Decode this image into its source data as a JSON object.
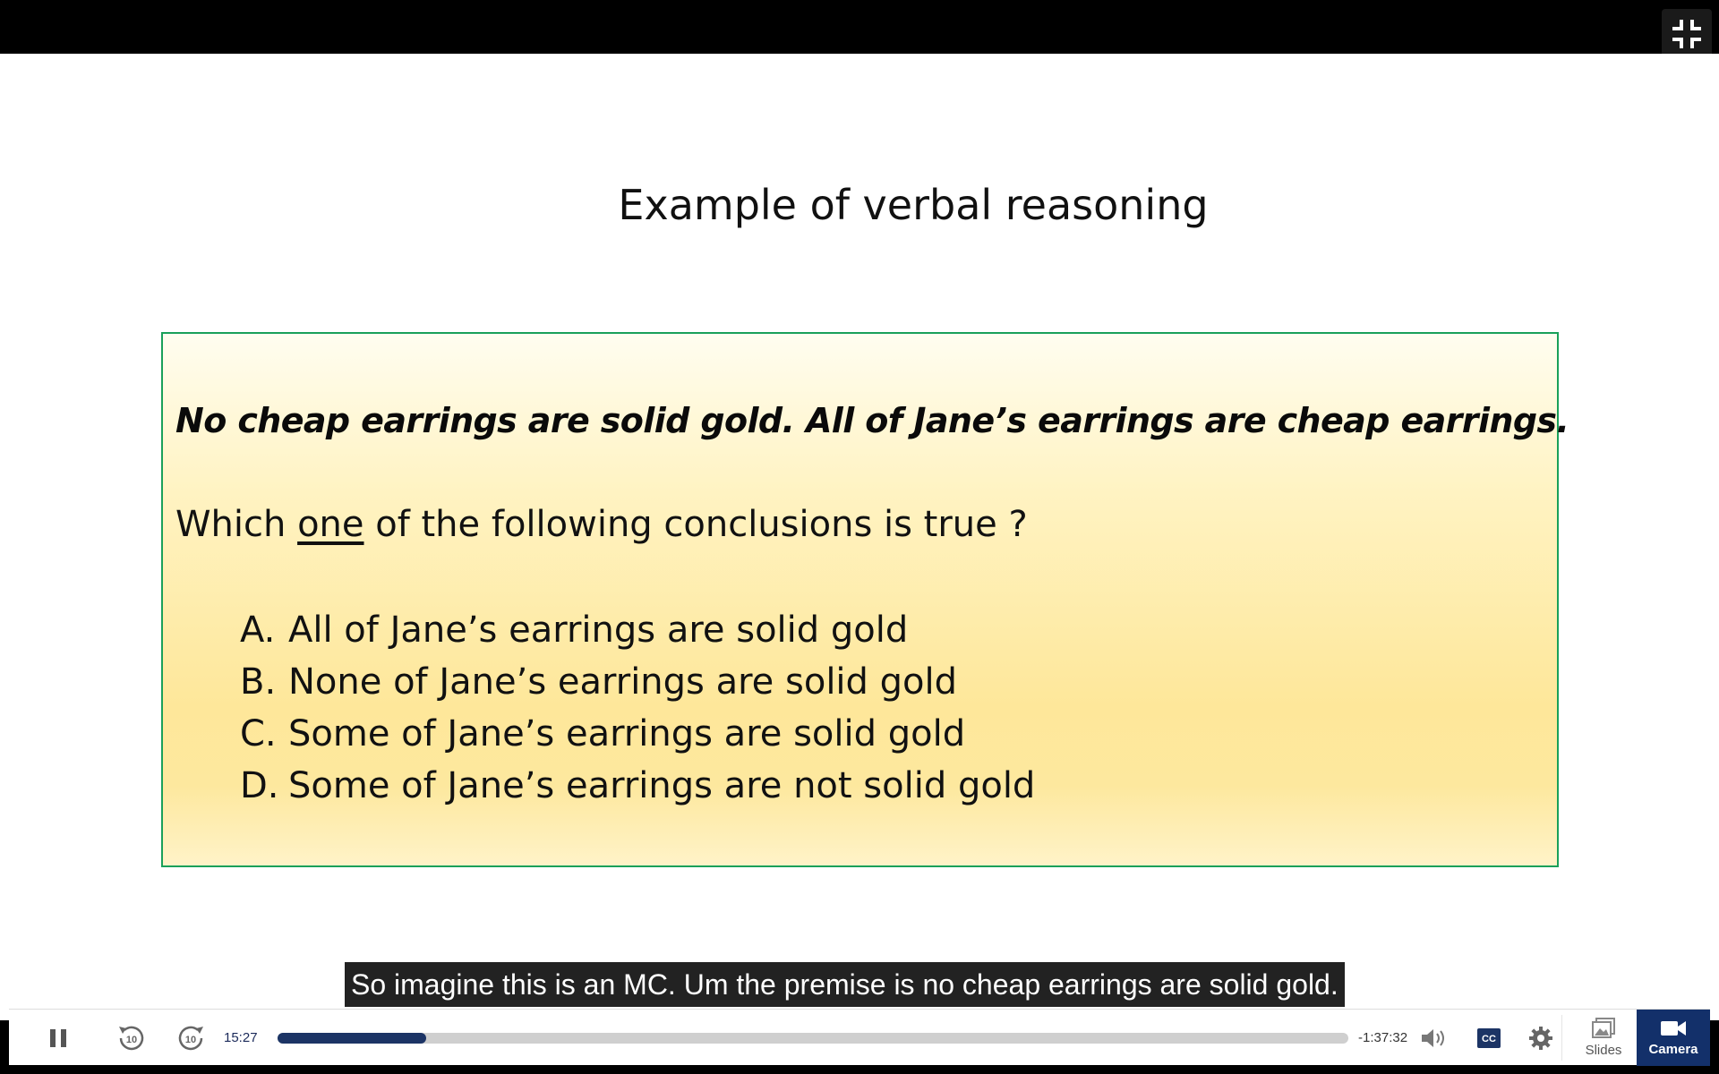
{
  "slide": {
    "title": "Example of verbal reasoning",
    "premise": "No cheap earrings are solid gold. All of Jane’s earrings are cheap earrings.",
    "question_before": "Which ",
    "question_underlined": "one",
    "question_after": " of the following conclusions is true ?",
    "options": [
      {
        "letter": "A.",
        "text": "All of Jane’s earrings are solid gold"
      },
      {
        "letter": "B.",
        "text": "None of Jane’s earrings are solid gold"
      },
      {
        "letter": "C.",
        "text": "Some of Jane’s earrings are solid gold"
      },
      {
        "letter": "D.",
        "text": "Some of Jane’s earrings are not solid gold"
      }
    ]
  },
  "caption": "So imagine this is an MC. Um the premise is no cheap earrings are solid gold.",
  "player": {
    "elapsed": "15:27",
    "remaining": "-1:37:32",
    "progress_fraction": 0.139,
    "skip_back_seconds": "10",
    "skip_forward_seconds": "10",
    "tabs": {
      "slides": "Slides",
      "camera": "Camera"
    },
    "accent_color": "#13306a"
  },
  "icons": [
    "exit-fullscreen-icon",
    "pause-icon",
    "rewind-10-icon",
    "forward-10-icon",
    "volume-icon",
    "closed-captions-icon",
    "gear-icon",
    "slides-icon",
    "camera-icon"
  ]
}
